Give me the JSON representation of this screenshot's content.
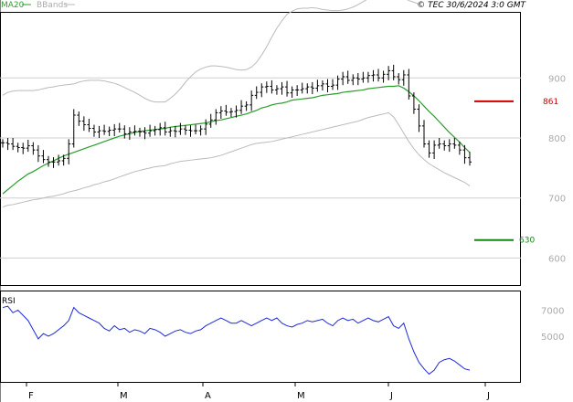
{
  "header": {
    "legend_ma": "MA20",
    "legend_bb": "BBands",
    "copyright": "© TEC 30/6/2024 3:0 GMT"
  },
  "rsi_label": "RSI",
  "colors": {
    "price": "#000000",
    "ma": "#2a9d2a",
    "bands": "#bbbbbb",
    "rsi": "#1e2ad8",
    "resistance": "#cc0000",
    "support": "#118811",
    "grid": "#cfcfcf",
    "frame": "#000000"
  },
  "chart_data": [
    {
      "type": "ohlc",
      "yticks": [
        "900",
        "800",
        "700",
        "600"
      ],
      "ylim": [
        555,
        1010
      ],
      "x_labels": [
        "F",
        "M",
        "A",
        "M",
        "J",
        "J"
      ],
      "levels": [
        {
          "name": "resistance",
          "value": 861,
          "label": "861"
        },
        {
          "name": "support",
          "value": 630,
          "label": "630"
        }
      ],
      "close": [
        792,
        790,
        786,
        784,
        783,
        787,
        780,
        770,
        764,
        760,
        760,
        762,
        766,
        790,
        838,
        828,
        822,
        816,
        810,
        812,
        811,
        813,
        815,
        815,
        807,
        810,
        811,
        810,
        808,
        812,
        814,
        817,
        810,
        812,
        811,
        815,
        813,
        812,
        812,
        815,
        823,
        830,
        842,
        845,
        843,
        844,
        846,
        853,
        855,
        871,
        876,
        885,
        886,
        880,
        882,
        885,
        875,
        880,
        880,
        882,
        885,
        883,
        887,
        890,
        886,
        888,
        898,
        902,
        896,
        900,
        898,
        900,
        904,
        905,
        900,
        906,
        912,
        902,
        897,
        905,
        870,
        848,
        820,
        790,
        775,
        788,
        790,
        787,
        790,
        788,
        780,
        767,
        760
      ],
      "ma20": [
        707,
        714,
        721,
        728,
        734,
        740,
        744,
        749,
        754,
        758,
        762,
        766,
        770,
        773,
        776,
        779,
        782,
        785,
        788,
        791,
        794,
        797,
        800,
        803,
        805,
        807,
        809,
        811,
        812,
        813,
        814,
        815,
        816,
        818,
        819,
        820,
        821,
        822,
        823,
        824,
        825,
        827,
        829,
        830,
        832,
        834,
        836,
        838,
        840,
        843,
        846,
        850,
        852,
        855,
        857,
        858,
        860,
        863,
        864,
        865,
        866,
        867,
        869,
        871,
        872,
        873,
        874,
        876,
        877,
        878,
        879,
        880,
        882,
        883,
        884,
        885,
        886,
        886,
        887,
        883,
        877,
        870,
        862,
        853,
        844,
        836,
        827,
        818,
        809,
        801,
        793,
        784,
        776
      ],
      "bb_upper": [
        871,
        876,
        878,
        879,
        879,
        879,
        879,
        880,
        882,
        884,
        885,
        887,
        888,
        889,
        890,
        893,
        895,
        896,
        896,
        896,
        895,
        893,
        891,
        888,
        884,
        880,
        876,
        871,
        866,
        862,
        860,
        860,
        860,
        866,
        873,
        882,
        893,
        902,
        910,
        915,
        918,
        920,
        920,
        919,
        918,
        916,
        914,
        913,
        914,
        918,
        926,
        938,
        952,
        968,
        983,
        995,
        1006,
        1011,
        1015,
        1016,
        1016,
        1017,
        1016,
        1014,
        1013,
        1012,
        1012,
        1013,
        1015,
        1018,
        1022,
        1027,
        1032,
        1036,
        1039,
        1040,
        1040,
        1039,
        1036,
        1033,
        1029,
        1026,
        1023
      ],
      "bb_lower": [
        685,
        688,
        689,
        691,
        693,
        695,
        697,
        698,
        700,
        702,
        703,
        705,
        707,
        710,
        712,
        714,
        717,
        719,
        722,
        724,
        727,
        729,
        732,
        735,
        738,
        741,
        744,
        746,
        748,
        750,
        752,
        753,
        754,
        757,
        759,
        761,
        762,
        763,
        764,
        765,
        766,
        767,
        769,
        771,
        774,
        777,
        780,
        783,
        786,
        789,
        791,
        792,
        793,
        794,
        796,
        798,
        800,
        802,
        804,
        806,
        808,
        810,
        812,
        814,
        816,
        818,
        820,
        822,
        824,
        826,
        828,
        831,
        834,
        836,
        838,
        840,
        842,
        835,
        822,
        808,
        794,
        782,
        772,
        764,
        757,
        752,
        747,
        742,
        738,
        734,
        730,
        726,
        720
      ]
    },
    {
      "type": "line",
      "name": "RSI",
      "yticks": [
        "7000",
        "5000"
      ],
      "ylim": [
        15,
        85
      ],
      "values": [
        72,
        73,
        68,
        70,
        66,
        62,
        55,
        48,
        52,
        50,
        52,
        55,
        58,
        62,
        72,
        68,
        66,
        64,
        62,
        60,
        56,
        54,
        58,
        55,
        56,
        53,
        55,
        54,
        52,
        56,
        55,
        53,
        50,
        52,
        54,
        55,
        53,
        52,
        54,
        55,
        58,
        60,
        62,
        64,
        62,
        60,
        60,
        62,
        60,
        58,
        60,
        62,
        64,
        62,
        64,
        60,
        58,
        57,
        59,
        60,
        62,
        61,
        62,
        63,
        60,
        58,
        62,
        64,
        62,
        63,
        60,
        62,
        64,
        62,
        61,
        63,
        65,
        58,
        56,
        60,
        48,
        38,
        30,
        25,
        21,
        24,
        30,
        32,
        33,
        31,
        28,
        25,
        24
      ]
    }
  ]
}
